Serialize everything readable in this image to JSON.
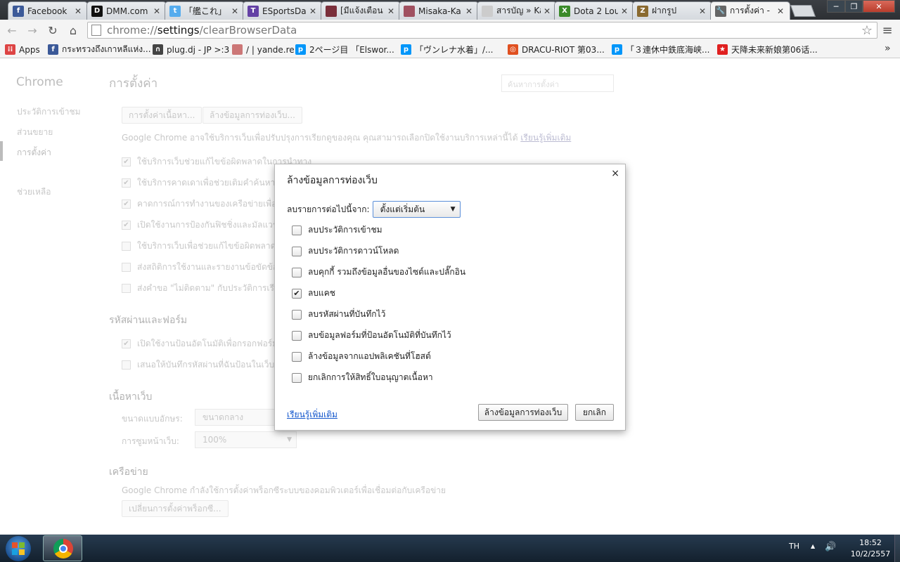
{
  "tabs": [
    {
      "title": "Facebook",
      "icon": "facebook-icon",
      "color": "#3b5998",
      "glyph": "f"
    },
    {
      "title": "DMM.com",
      "icon": "dmm-icon",
      "color": "#111111",
      "glyph": "D"
    },
    {
      "title": "「艦これ」",
      "icon": "twitter-icon",
      "color": "#55acee",
      "glyph": "t"
    },
    {
      "title": "ESportsDai",
      "icon": "twitch-icon",
      "color": "#6441a5",
      "glyph": "T"
    },
    {
      "title": "[มีแจ้งเตือน",
      "icon": "image-icon",
      "color": "#7a2f3b",
      "glyph": ""
    },
    {
      "title": "Misaka-Ka",
      "icon": "avatar-icon",
      "color": "#a05060",
      "glyph": ""
    },
    {
      "title": "สารบัญ » Ka",
      "icon": "page-icon",
      "color": "#cccccc",
      "glyph": ""
    },
    {
      "title": "Dota 2 Lou",
      "icon": "dota-icon",
      "color": "#3a8a2a",
      "glyph": "X"
    },
    {
      "title": "ฝากรูป",
      "icon": "image-host-icon",
      "color": "#8a6a30",
      "glyph": "Z"
    },
    {
      "title": "การตั้งค่า -",
      "icon": "wrench-icon",
      "color": "#666666",
      "glyph": "🔧",
      "active": true
    }
  ],
  "window": {
    "minimize": "─",
    "maximize": "❐",
    "close": "✕"
  },
  "toolbar": {
    "back": "←",
    "forward": "→",
    "reload": "↻",
    "home": "⌂",
    "url_scheme": "chrome://",
    "url_host": "settings",
    "url_path": "/clearBrowserData",
    "star": "☆",
    "menu": "≡"
  },
  "bookmarks": [
    {
      "label": "Apps",
      "icon": "apps-grid-icon",
      "color": "#d44",
      "glyph": "⁞⁞"
    },
    {
      "label": "กระทรวงถึงเกาหลีแห่ง...",
      "icon": "facebook-icon",
      "color": "#3b5998",
      "glyph": "f"
    },
    {
      "label": "plug.dj - JP >:3",
      "icon": "headphones-icon",
      "color": "#444444",
      "glyph": "∩"
    },
    {
      "label": "/ | yande.re",
      "icon": "yandere-icon",
      "color": "#c77",
      "glyph": ""
    },
    {
      "label": "2ページ目 「Elswor...",
      "icon": "pixiv-icon",
      "color": "#0096fa",
      "glyph": "p"
    },
    {
      "label": "「ヴンレナ水着」/...",
      "icon": "pixiv-icon",
      "color": "#0096fa",
      "glyph": "p"
    },
    {
      "label": "DRACU-RIOT 第03...",
      "icon": "dracu-icon",
      "color": "#e05020",
      "glyph": "◎"
    },
    {
      "label": "「３連休中鉄底海峡...",
      "icon": "pixiv-icon",
      "color": "#0096fa",
      "glyph": "p"
    },
    {
      "label": "天降未来新娘第06话...",
      "icon": "bookmark-icon",
      "color": "#e02020",
      "glyph": "★"
    }
  ],
  "bookmarks_overflow": "»",
  "settings": {
    "brand": "Chrome",
    "page_title": "การตั้งค่า",
    "search_placeholder": "ค้นหาการตั้งค่า",
    "sidebar": [
      "ประวัติการเข้าชม",
      "ส่วนขยาย",
      "การตั้งค่า",
      "ช่วยเหลือ"
    ],
    "privacy_buttons": [
      "การตั้งค่าเนื้อหา...",
      "ล้างข้อมูลการท่องเว็บ..."
    ],
    "privacy_desc": "Google Chrome อาจใช้บริการเว็บเพื่อปรับปรุงการเรียกดูของคุณ คุณสามารถเลือกปิดใช้งานบริการเหล่านี้ได้",
    "learn_more": "เรียนรู้เพิ่มเติม",
    "privacy_options": [
      {
        "label": "ใช้บริการเว็บช่วยแก้ไขข้อผิดพลาดในการนำทาง",
        "checked": true
      },
      {
        "label": "ใช้บริการคาดเดาเพื่อช่วยเติมคำค้นหาและ",
        "checked": true
      },
      {
        "label": "คาดการณ์การทำงานของเครือข่ายเพื่อพั",
        "checked": true
      },
      {
        "label": "เปิดใช้งานการป้องกันฟิชชิ่งและมัลแวร์",
        "checked": true
      },
      {
        "label": "ใช้บริการเว็บเพื่อช่วยแก้ไขข้อผิดพลาดใน",
        "checked": false
      },
      {
        "label": "ส่งสถิติการใช้งานและรายงานข้อขัดข้องไ",
        "checked": false
      },
      {
        "label": "ส่งคำขอ \"ไม่ติดตาม\" กับประวัติการเรียกดู",
        "checked": false
      }
    ],
    "passwords_heading": "รหัสผ่านและฟอร์ม",
    "passwords_options": [
      {
        "label": "เปิดใช้งานป้อนอัตโนมัติเพื่อกรอกฟอร์มบน",
        "checked": true
      },
      {
        "label": "เสนอให้บันทึกรหัสผ่านที่ฉันป้อนในเว็บ",
        "checked": false
      }
    ],
    "web_content_heading": "เนื้อหาเว็บ",
    "font_size_label": "ขนาดแบบอักษร:",
    "font_size_value": "ขนาดกลาง",
    "zoom_label": "การซูมหน้าเว็บ:",
    "zoom_value": "100%",
    "network_heading": "เครือข่าย",
    "network_desc": "Google Chrome กำลังใช้การตั้งค่าพร็อกซีระบบของคอมพิวเตอร์เพื่อเชื่อมต่อกับเครือข่าย",
    "proxy_button": "เปลี่ยนการตั้งค่าพร็อกซี..."
  },
  "dialog": {
    "title": "ล้างข้อมูลการท่องเว็บ",
    "close": "×",
    "range_label": "ลบรายการต่อไปนี้จาก:",
    "range_value": "ตั้งแต่เริ่มต้น",
    "options": [
      {
        "label": "ลบประวัติการเข้าชม",
        "checked": false
      },
      {
        "label": "ลบประวัติการดาวน์โหลด",
        "checked": false
      },
      {
        "label": "ลบคุกกี้ รวมถึงข้อมูลอื่นของไซต์และปลั๊กอิน",
        "checked": false
      },
      {
        "label": "ลบแคช",
        "checked": true
      },
      {
        "label": "ลบรหัสผ่านที่บันทึกไว้",
        "checked": false
      },
      {
        "label": "ลบข้อมูลฟอร์มที่ป้อนอัตโนมัติที่บันทึกไว้",
        "checked": false
      },
      {
        "label": "ล้างข้อมูลจากแอปพลิเคชันที่โฮสต์",
        "checked": false
      },
      {
        "label": "ยกเลิกการให้สิทธิ์ใบอนุญาตเนื้อหา",
        "checked": false
      }
    ],
    "learn_more": "เรียนรู้เพิ่มเติม",
    "confirm": "ล้างข้อมูลการท่องเว็บ",
    "cancel": "ยกเลิก"
  },
  "taskbar": {
    "language": "TH",
    "tray_arrow": "▲",
    "volume": "🔊",
    "time": "18:52",
    "date": "10/2/2557"
  }
}
